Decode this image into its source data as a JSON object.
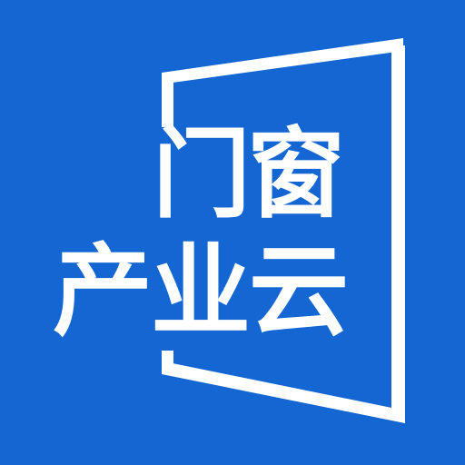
{
  "app_icon": {
    "background_color": "#1466d2",
    "foreground_color": "#ffffff",
    "symbol": "door-frame-icon",
    "text_line_1": "门窗",
    "text_line_2": "产业云"
  }
}
